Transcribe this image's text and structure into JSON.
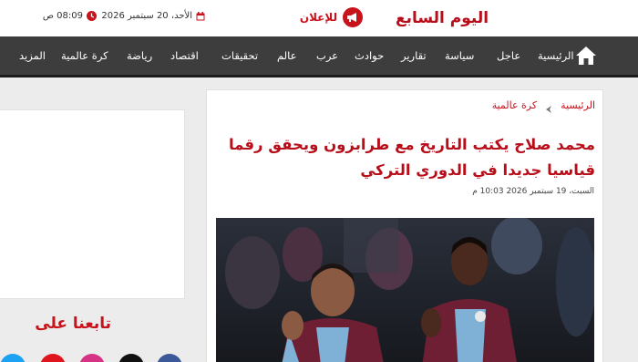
{
  "header": {
    "logo_red": "اليوم السابع",
    "ad_label": "للإعلان",
    "date": "الأحد، 20 سبتمبر 2026",
    "time": "08:09 ص"
  },
  "nav": {
    "items": [
      "الرئيسية",
      "عاجل",
      "سياسة",
      "تقارير",
      "حوادث",
      "عرب",
      "عالم",
      "تحقيقات",
      "اقتصاد",
      "رياضة",
      "كرة عالمية",
      "المزيد"
    ]
  },
  "breadcrumb": {
    "home": "الرئيسية",
    "category": "كرة عالمية"
  },
  "article": {
    "title": "محمد صلاح يكتب التاريخ مع طرابزون ويحقق رقما قياسيا جديدا في الدوري التركي",
    "date": "السبت، 19 سبتمبر 2026 10:03 م"
  },
  "sidebar": {
    "follow_title": "تابعنا على"
  },
  "colors": {
    "brand_red": "#c8121c",
    "nav_bg": "#3d3d3d",
    "title_red": "#b70e1a"
  }
}
